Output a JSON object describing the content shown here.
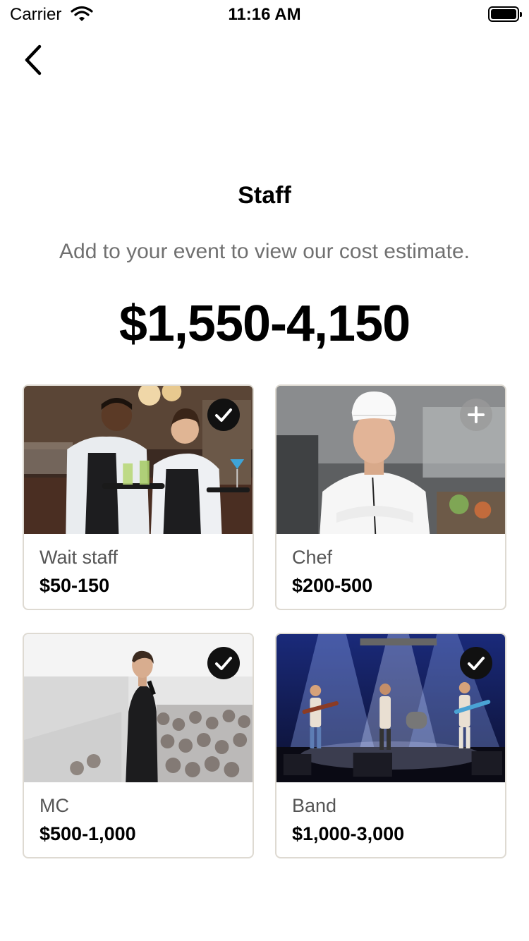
{
  "status_bar": {
    "carrier": "Carrier",
    "time": "11:16 AM"
  },
  "header": {
    "title": "Staff",
    "subtitle": "Add to your event to view our cost estimate.",
    "total": "$1,550-4,150"
  },
  "staff": [
    {
      "name": "Wait staff",
      "price": "$50-150",
      "selected": true,
      "icon": "check-icon"
    },
    {
      "name": "Chef",
      "price": "$200-500",
      "selected": false,
      "icon": "plus-icon"
    },
    {
      "name": "MC",
      "price": "$500-1,000",
      "selected": true,
      "icon": "check-icon"
    },
    {
      "name": "Band",
      "price": "$1,000-3,000",
      "selected": true,
      "icon": "check-icon"
    }
  ],
  "colors": {
    "card_border": "#dedad2",
    "subtitle_text": "#707070",
    "badge_selected": "#111111",
    "badge_unselected": "#9a9a9a"
  }
}
